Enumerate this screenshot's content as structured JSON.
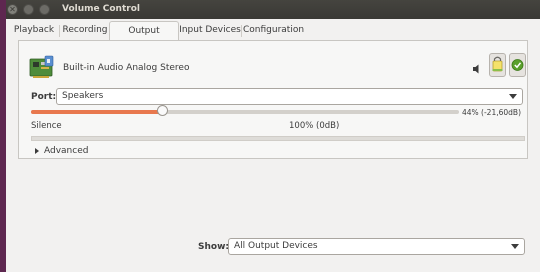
{
  "window": {
    "title": "Volume Control"
  },
  "tabs": [
    {
      "label": "Playback"
    },
    {
      "label": "Recording"
    },
    {
      "label": "Output Devices",
      "active": true
    },
    {
      "label": "Input Devices"
    },
    {
      "label": "Configuration"
    }
  ],
  "device": {
    "name": "Built-in Audio Analog Stereo",
    "icon": "sound-card-icon",
    "mute_icon": "speaker-icon",
    "lock_icon": "lock-icon",
    "default_icon": "checkmark-icon",
    "port_label": "Port:",
    "port_value": "Speakers",
    "volume_fraction": 0.44,
    "volume_text": "44% (-21,60dB)",
    "silence_label": "Silence",
    "hundred_label": "100% (0dB)",
    "advanced_label": "Advanced"
  },
  "footer": {
    "show_label": "Show:",
    "show_value": "All Output Devices"
  },
  "colors": {
    "accent": "#e8784e",
    "titlebar": "#3c3b37",
    "desktop": "#5e2750"
  }
}
